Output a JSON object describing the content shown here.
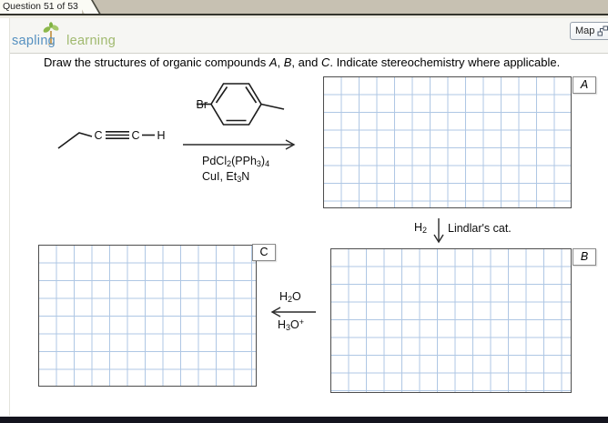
{
  "header": {
    "tab_title": "Question 51 of 53",
    "map_label": "Map",
    "brand": {
      "word1": "sapling",
      "word2": "learning"
    }
  },
  "question": {
    "part1": "Draw the structures of organic compounds ",
    "a": "A",
    "sep1": ", ",
    "b": "B",
    "sep2": ", and ",
    "c": "C",
    "part2": ". Indicate stereochemistry where applicable."
  },
  "scheme": {
    "alkyne": {
      "c1": "C",
      "c2": "C",
      "h": "H"
    },
    "aryl_halide": {
      "br": "Br"
    },
    "step1": {
      "catalyst": {
        "t1": "PdCl",
        "s1": "2",
        "t2": "(PPh",
        "s2": "3",
        "t3": ")",
        "s3": "4"
      },
      "reagents": {
        "t1": "CuI, Et",
        "s1": "3",
        "t2": "N"
      }
    },
    "step2": {
      "t1": "H",
      "s1": "2",
      "label": "Lindlar's cat."
    },
    "step3": {
      "above": {
        "t1": "H",
        "s1": "2",
        "t2": "O"
      },
      "below": {
        "t1": "H",
        "s1": "3",
        "t2": "O",
        "sup": "+"
      }
    }
  },
  "boxes": {
    "a": "A",
    "b": "B",
    "c": "C"
  },
  "colors": {
    "grid_line": "#afc7e4",
    "tab_bar_bg": "#c7c1b2",
    "brand_blue": "#5590c0",
    "brand_green": "#a0b96e",
    "bottom_bar": "#14141e"
  }
}
